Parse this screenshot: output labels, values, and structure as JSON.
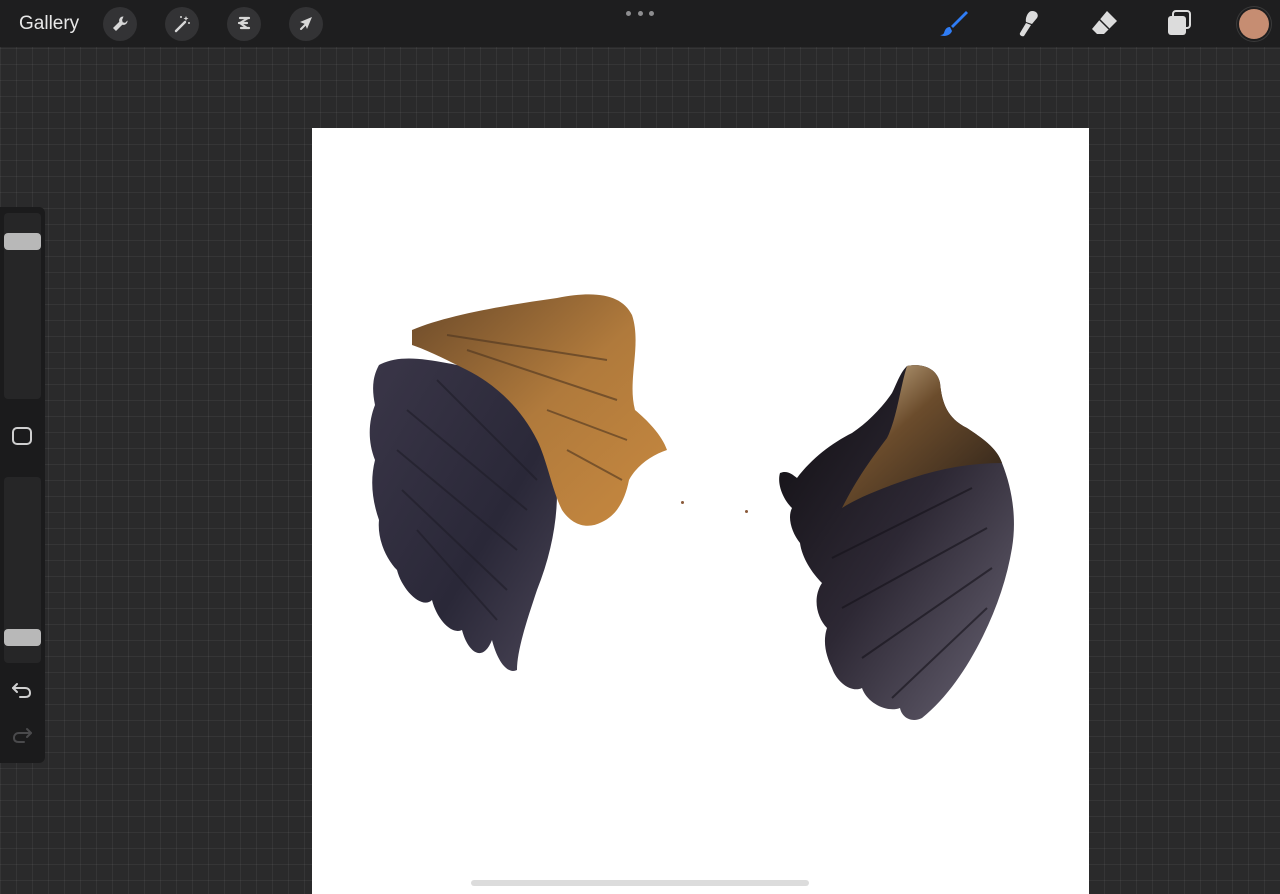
{
  "topbar": {
    "gallery_label": "Gallery",
    "left_tools": [
      {
        "icon": "wrench-icon",
        "name": "actions"
      },
      {
        "icon": "magic-wand-icon",
        "name": "adjustments"
      },
      {
        "icon": "selection-icon",
        "name": "selection"
      },
      {
        "icon": "arrow-cursor-icon",
        "name": "transform"
      }
    ],
    "right_tools": [
      {
        "icon": "brush-icon",
        "name": "paint",
        "active": true
      },
      {
        "icon": "smudge-icon",
        "name": "smudge"
      },
      {
        "icon": "eraser-icon",
        "name": "erase"
      },
      {
        "icon": "layers-icon",
        "name": "layers"
      }
    ],
    "current_color": "#c68d72",
    "active_color": "#2f7df6"
  },
  "sidebar": {
    "brush_size": 0.88,
    "brush_opacity": 0.1
  },
  "canvas": {
    "background": "#ffffff",
    "content": [
      "left-wing-image",
      "right-wing-image"
    ]
  }
}
